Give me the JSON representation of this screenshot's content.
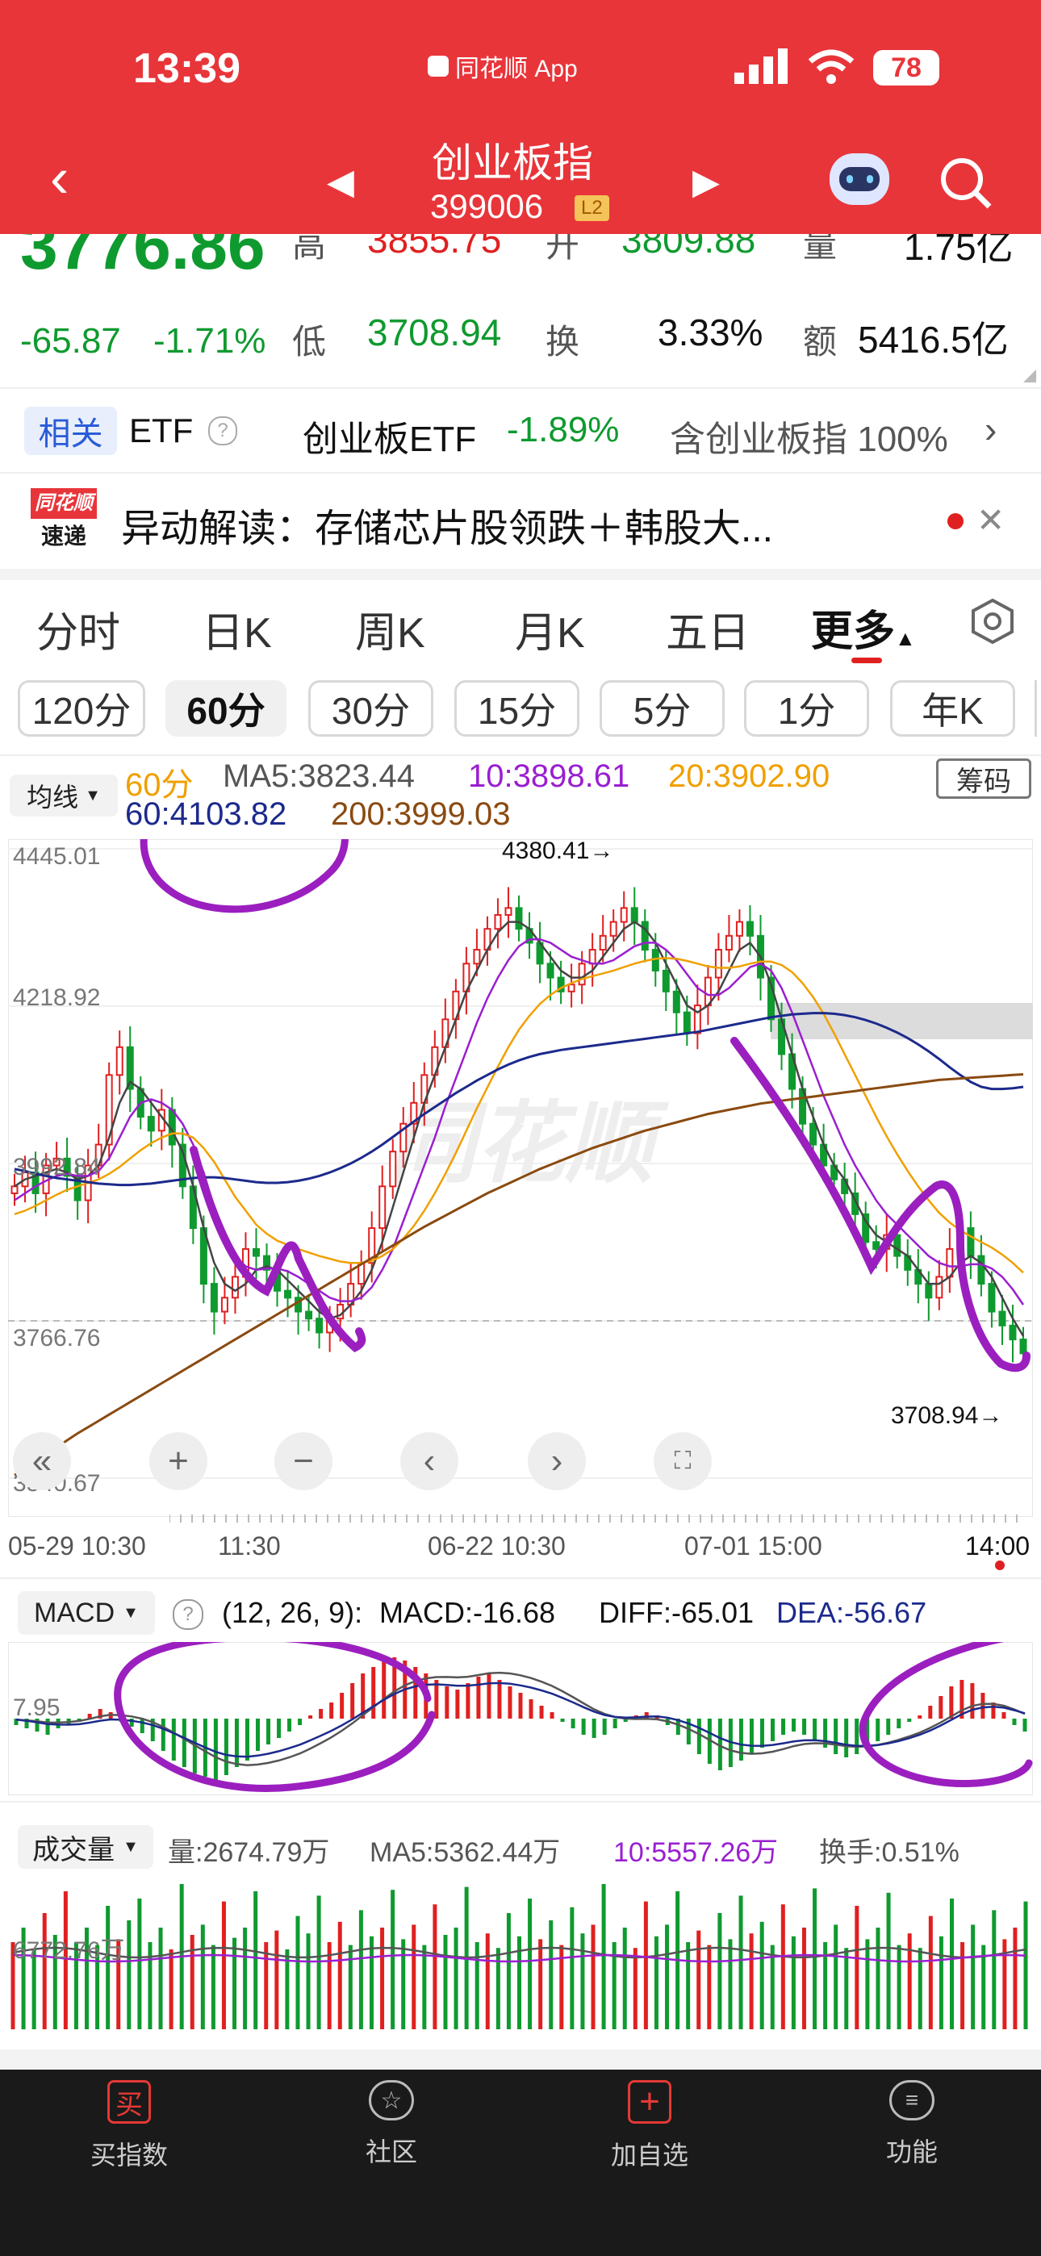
{
  "status": {
    "time": "13:39",
    "app_badge": "同花顺 App",
    "battery": "78"
  },
  "header": {
    "title": "创业板指",
    "code": "399006",
    "level": "L2"
  },
  "quote": {
    "price": "3776.86",
    "change": "-65.87",
    "change_pct": "-1.71%",
    "high_label": "高",
    "high": "3855.75",
    "open_label": "开",
    "open": "3809.88",
    "volume_label": "量",
    "volume": "1.75亿",
    "low_label": "低",
    "low": "3708.94",
    "turnover_label": "换",
    "turnover": "3.33%",
    "amount_label": "额",
    "amount": "5416.5亿"
  },
  "etf": {
    "tag": "相关",
    "label": "ETF",
    "name": "创业板ETF",
    "pct": "-1.89%",
    "holding": "含创业板指 100%"
  },
  "news": {
    "logo_top": "同花顺",
    "logo_bottom": "速递",
    "text": "异动解读：存储芯片股领跌＋韩股大..."
  },
  "tabs": [
    "分时",
    "日K",
    "周K",
    "月K",
    "五日",
    "更多"
  ],
  "periods": [
    "120分",
    "60分",
    "30分",
    "15分",
    "5分",
    "1分",
    "年K"
  ],
  "ma": {
    "selector": "均线",
    "period": "60分",
    "ma5": "MA5:3823.44",
    "ma10": "10:3898.61",
    "ma20": "20:3902.90",
    "ma60": "60:4103.82",
    "ma200": "200:3999.03",
    "chips": "筹码"
  },
  "axis": {
    "y_labels": [
      "4445.01",
      "4218.92",
      "3992.84",
      "3766.76",
      "3540.67"
    ],
    "high_marker": "4380.41→",
    "low_marker": "3708.94→",
    "x_labels": [
      "05-29 10:30",
      "11:30",
      "06-22 10:30",
      "07-01 15:00",
      "14:00"
    ]
  },
  "macd": {
    "selector": "MACD",
    "params": "(12, 26, 9):",
    "macd": "MACD:-16.68",
    "diff": "DIFF:-65.01",
    "dea": "DEA:-56.67",
    "scale": "7.95"
  },
  "vol": {
    "selector": "成交量",
    "amount": "量:2674.79万",
    "ma5": "MA5:5362.44万",
    "ma10": "10:5557.26万",
    "turnover": "换手:0.51%",
    "scale": "6772.76万"
  },
  "nav": [
    "买指数",
    "社区",
    "加自选",
    "功能"
  ],
  "watermark": "同花顺",
  "colors": {
    "up": "#e02020",
    "down": "#0f9a2f",
    "brand": "#e8353a",
    "annotation": "#9b1fbf"
  },
  "chart_data": [
    {
      "type": "candlestick",
      "title": "",
      "ylim": [
        3540.67,
        4445.01
      ],
      "x_ticks": [
        "05-29 10:30",
        "11:30",
        "06-22 10:30",
        "07-01 15:00",
        "14:00"
      ],
      "close": [
        3960,
        3980,
        3950,
        3990,
        4000,
        3975,
        3940,
        3990,
        4020,
        4120,
        4160,
        4100,
        4060,
        4040,
        4070,
        4020,
        3960,
        3900,
        3820,
        3780,
        3800,
        3830,
        3870,
        3860,
        3840,
        3810,
        3800,
        3780,
        3770,
        3750,
        3770,
        3790,
        3820,
        3850,
        3900,
        3960,
        4010,
        4050,
        4080,
        4120,
        4160,
        4200,
        4240,
        4280,
        4300,
        4330,
        4350,
        4360,
        4330,
        4310,
        4280,
        4260,
        4240,
        4250,
        4280,
        4300,
        4320,
        4340,
        4360,
        4340,
        4300,
        4270,
        4240,
        4210,
        4180,
        4220,
        4260,
        4300,
        4320,
        4340,
        4320,
        4260,
        4200,
        4150,
        4100,
        4050,
        4020,
        3990,
        3970,
        3950,
        3920,
        3880,
        3870,
        3890,
        3860,
        3840,
        3820,
        3800,
        3830,
        3870,
        3900,
        3860,
        3820,
        3780,
        3760,
        3740,
        3720
      ],
      "series": [
        {
          "name": "MA5",
          "values": [
            3960,
            3970,
            3975,
            3980,
            3985,
            3980,
            3970,
            3975,
            3990,
            4030,
            4080,
            4110,
            4100,
            4080,
            4060,
            4040,
            4010,
            3960,
            3900,
            3850,
            3820,
            3810,
            3820,
            3840,
            3845,
            3840,
            3825,
            3810,
            3795,
            3780,
            3770,
            3775,
            3790,
            3810,
            3840,
            3880,
            3930,
            3980,
            4030,
            4080,
            4120,
            4160,
            4200,
            4240,
            4270,
            4300,
            4325,
            4340,
            4340,
            4330,
            4310,
            4290,
            4270,
            4260,
            4260,
            4270,
            4290,
            4310,
            4330,
            4340,
            4330,
            4310,
            4280,
            4250,
            4220,
            4210,
            4220,
            4240,
            4270,
            4300,
            4310,
            4290,
            4250,
            4200,
            4150,
            4100,
            4060,
            4020,
            3990,
            3970,
            3940,
            3910,
            3890,
            3880,
            3870,
            3860,
            3840,
            3820,
            3820,
            3830,
            3850,
            3860,
            3850,
            3830,
            3800,
            3770,
            3745
          ]
        },
        {
          "name": "10",
          "values": [
            3940,
            3950,
            3960,
            3968,
            3975,
            3978,
            3975,
            3975,
            3982,
            4000,
            4030,
            4060,
            4080,
            4085,
            4080,
            4070,
            4050,
            4020,
            3980,
            3930,
            3890,
            3860,
            3845,
            3840,
            3842,
            3842,
            3838,
            3830,
            3820,
            3810,
            3800,
            3795,
            3795,
            3800,
            3815,
            3840,
            3870,
            3910,
            3950,
            3990,
            4030,
            4075,
            4115,
            4155,
            4195,
            4230,
            4260,
            4285,
            4305,
            4315,
            4315,
            4310,
            4300,
            4290,
            4285,
            4280,
            4280,
            4285,
            4295,
            4305,
            4310,
            4310,
            4300,
            4285,
            4265,
            4245,
            4235,
            4235,
            4245,
            4260,
            4275,
            4280,
            4270,
            4245,
            4210,
            4170,
            4130,
            4090,
            4055,
            4020,
            3990,
            3965,
            3940,
            3920,
            3905,
            3890,
            3875,
            3860,
            3850,
            3845,
            3845,
            3848,
            3848,
            3842,
            3830,
            3812,
            3790
          ]
        },
        {
          "name": "20",
          "values": [
            3920,
            3925,
            3932,
            3940,
            3948,
            3955,
            3960,
            3965,
            3970,
            3978,
            3988,
            4000,
            4012,
            4022,
            4030,
            4036,
            4036,
            4030,
            4015,
            3995,
            3970,
            3945,
            3925,
            3905,
            3892,
            3882,
            3876,
            3870,
            3865,
            3860,
            3856,
            3852,
            3850,
            3850,
            3853,
            3860,
            3870,
            3885,
            3903,
            3925,
            3950,
            3978,
            4008,
            4040,
            4072,
            4102,
            4132,
            4160,
            4185,
            4205,
            4222,
            4235,
            4245,
            4252,
            4258,
            4262,
            4266,
            4270,
            4275,
            4280,
            4284,
            4287,
            4288,
            4287,
            4284,
            4280,
            4276,
            4274,
            4274,
            4276,
            4280,
            4283,
            4283,
            4278,
            4268,
            4252,
            4232,
            4208,
            4180,
            4150,
            4120,
            4090,
            4060,
            4032,
            4006,
            3982,
            3960,
            3940,
            3922,
            3908,
            3897,
            3888,
            3880,
            3872,
            3862,
            3850,
            3836
          ]
        },
        {
          "name": "60",
          "values": [
            3985,
            3982,
            3978,
            3975,
            3972,
            3970,
            3968,
            3966,
            3964,
            3963,
            3962,
            3962,
            3963,
            3964,
            3966,
            3968,
            3970,
            3972,
            3973,
            3973,
            3972,
            3970,
            3968,
            3966,
            3965,
            3965,
            3966,
            3968,
            3971,
            3975,
            3980,
            3986,
            3993,
            4001,
            4010,
            4020,
            4031,
            4042,
            4053,
            4064,
            4074,
            4084,
            4094,
            4103,
            4112,
            4120,
            4128,
            4135,
            4141,
            4146,
            4150,
            4153,
            4156,
            4158,
            4160,
            4162,
            4164,
            4166,
            4168,
            4170,
            4172,
            4174,
            4176,
            4178,
            4180,
            4182,
            4185,
            4188,
            4191,
            4194,
            4197,
            4200,
            4203,
            4205,
            4207,
            4208,
            4209,
            4209,
            4208,
            4206,
            4203,
            4199,
            4194,
            4188,
            4181,
            4173,
            4164,
            4154,
            4143,
            4131,
            4120,
            4110,
            4103,
            4100,
            4100,
            4101,
            4103
          ]
        },
        {
          "name": "200",
          "values": [
            3545,
            3555,
            3565,
            3575,
            3585,
            3595,
            3605,
            3614,
            3623,
            3632,
            3641,
            3650,
            3659,
            3668,
            3677,
            3686,
            3695,
            3704,
            3713,
            3722,
            3731,
            3740,
            3749,
            3758,
            3767,
            3776,
            3785,
            3794,
            3803,
            3812,
            3821,
            3830,
            3839,
            3848,
            3857,
            3866,
            3875,
            3884,
            3893,
            3902,
            3910,
            3918,
            3926,
            3934,
            3942,
            3950,
            3957,
            3964,
            3971,
            3978,
            3985,
            3991,
            3997,
            4003,
            4009,
            4015,
            4020,
            4025,
            4030,
            4035,
            4040,
            4044,
            4048,
            4052,
            4056,
            4060,
            4064,
            4067,
            4070,
            4073,
            4076,
            4079,
            4081,
            4083,
            4085,
            4087,
            4089,
            4091,
            4093,
            4095,
            4097,
            4099,
            4101,
            4103,
            4105,
            4107,
            4109,
            4111,
            4113,
            4114,
            4115,
            4116,
            4117,
            4118,
            4119,
            4120,
            4121
          ]
        }
      ]
    },
    {
      "type": "bar",
      "title": "",
      "series": [
        {
          "name": "MACD",
          "values": [
            -4,
            -6,
            -8,
            -10,
            -6,
            -4,
            -2,
            3,
            6,
            4,
            -2,
            -5,
            -9,
            -14,
            -20,
            -26,
            -30,
            -34,
            -36,
            -38,
            -35,
            -30,
            -26,
            -20,
            -16,
            -12,
            -8,
            -4,
            2,
            6,
            10,
            16,
            22,
            28,
            32,
            36,
            38,
            36,
            32,
            28,
            24,
            20,
            18,
            22,
            26,
            28,
            24,
            20,
            16,
            12,
            8,
            4,
            -2,
            -6,
            -10,
            -12,
            -10,
            -6,
            -2,
            2,
            4,
            2,
            -4,
            -10,
            -16,
            -22,
            -28,
            -32,
            -30,
            -26,
            -22,
            -18,
            -14,
            -10,
            -8,
            -10,
            -14,
            -18,
            -22,
            -24,
            -22,
            -18,
            -14,
            -10,
            -6,
            -2,
            2,
            8,
            14,
            20,
            24,
            22,
            16,
            10,
            4,
            -4,
            -8
          ]
        }
      ]
    },
    {
      "type": "bar",
      "title": "",
      "series": [
        {
          "name": "成交量",
          "values": [
            60,
            70,
            55,
            80,
            65,
            95,
            60,
            70,
            58,
            85,
            62,
            75,
            90,
            60,
            70,
            55,
            100,
            65,
            72,
            58,
            88,
            63,
            70,
            95,
            60,
            68,
            55,
            78,
            66,
            92,
            60,
            74,
            58,
            82,
            64,
            70,
            96,
            62,
            72,
            58,
            86,
            65,
            70,
            98,
            60,
            66,
            56,
            80,
            64,
            90,
            62,
            75,
            58,
            84,
            66,
            72,
            100,
            60,
            70,
            56,
            88,
            64,
            72,
            95,
            60,
            68,
            58,
            80,
            62,
            92,
            66,
            74,
            58,
            86,
            64,
            70,
            97,
            60,
            72,
            56,
            85,
            62,
            70,
            94,
            58,
            66,
            56,
            78,
            64,
            90,
            60,
            72,
            58,
            82,
            62,
            70,
            88
          ]
        }
      ]
    }
  ]
}
